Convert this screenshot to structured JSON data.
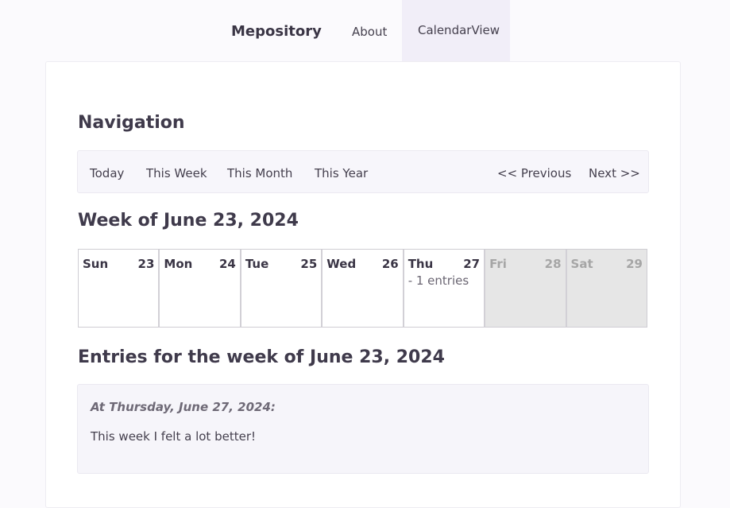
{
  "topnav": {
    "brand": "Mepository",
    "about": "About",
    "calendar_view": "CalendarView"
  },
  "navigation": {
    "heading": "Navigation",
    "today": "Today",
    "this_week": "This Week",
    "this_month": "This Month",
    "this_year": "This Year",
    "previous": "<< Previous",
    "next": "Next >>"
  },
  "week": {
    "heading": "Week of June 23, 2024",
    "days": [
      {
        "name": "Sun",
        "num": "23",
        "entries": ""
      },
      {
        "name": "Mon",
        "num": "24",
        "entries": ""
      },
      {
        "name": "Tue",
        "num": "25",
        "entries": ""
      },
      {
        "name": "Wed",
        "num": "26",
        "entries": ""
      },
      {
        "name": "Thu",
        "num": "27",
        "entries": "- 1 entries"
      },
      {
        "name": "Fri",
        "num": "28",
        "entries": ""
      },
      {
        "name": "Sat",
        "num": "29",
        "entries": ""
      }
    ],
    "colors": {
      "future_bg": "#e6e6e6",
      "future_text": "#a6a6a6"
    }
  },
  "entries": {
    "heading": "Entries for the week of June 23, 2024",
    "items": [
      {
        "date": "At Thursday, June 27, 2024:",
        "text": "This week I felt a lot better!"
      }
    ]
  }
}
